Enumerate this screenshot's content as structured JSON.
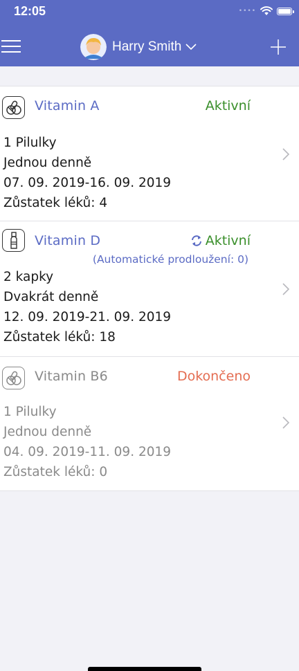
{
  "status_bar": {
    "time": "12:05"
  },
  "nav": {
    "user_name": "Harry Smith"
  },
  "medications": [
    {
      "name": "Vitamin A",
      "icon": "pills-icon",
      "status": "Aktivní",
      "dose": "1 Pilulky",
      "frequency": "Jednou denně",
      "period": "07. 09. 2019-16. 09. 2019",
      "remaining": "Zůstatek léků: 4"
    },
    {
      "name": "Vitamin D",
      "icon": "dropper-bottle-icon",
      "status": "Aktivní",
      "auto_extension": "(Automatické prodloužení: 0)",
      "dose": "2 kapky",
      "frequency": "Dvakrát denně",
      "period": "12. 09. 2019-21. 09. 2019",
      "remaining": "Zůstatek léků: 18"
    },
    {
      "name": "Vitamin B6",
      "icon": "pills-icon",
      "status": "Dokončeno",
      "dose": "1 Pilulky",
      "frequency": "Jednou denně",
      "period": "04. 09. 2019-11. 09. 2019",
      "remaining": "Zůstatek léků: 0"
    }
  ],
  "colors": {
    "header": "#5b6bc4",
    "active": "#3a8f2b",
    "finished": "#e46d52",
    "background": "#f2f2f7"
  }
}
